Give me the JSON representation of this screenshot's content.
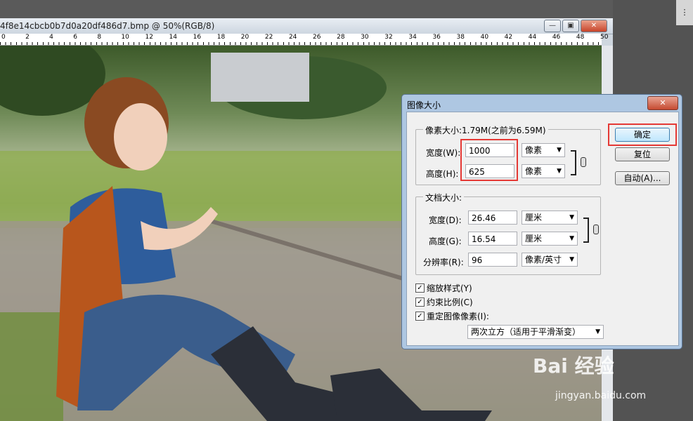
{
  "document": {
    "title": "4f8e14cbcb0b7d0a20df486d7.bmp @ 50%(RGB/8)",
    "window_buttons": [
      "—",
      "▣",
      "✕"
    ],
    "ruler_ticks": [
      "0",
      "2",
      "4",
      "6",
      "8",
      "10",
      "12",
      "14",
      "16",
      "18",
      "20",
      "22",
      "24",
      "26",
      "28",
      "30",
      "32",
      "34",
      "36",
      "38",
      "40",
      "42",
      "44",
      "46",
      "48",
      "50"
    ]
  },
  "dialog": {
    "title": "图像大小",
    "close_glyph": "✕",
    "pixel_group": {
      "legend": "像素大小:1.79M(之前为6.59M)",
      "width_label": "宽度(W):",
      "width_value": "1000",
      "width_unit": "像素",
      "height_label": "高度(H):",
      "height_value": "625",
      "height_unit": "像素"
    },
    "doc_group": {
      "legend": "文档大小:",
      "width_label": "宽度(D):",
      "width_value": "26.46",
      "width_unit": "厘米",
      "height_label": "高度(G):",
      "height_value": "16.54",
      "height_unit": "厘米",
      "res_label": "分辨率(R):",
      "res_value": "96",
      "res_unit": "像素/英寸"
    },
    "buttons": {
      "ok": "确定",
      "reset": "复位",
      "auto": "自动(A)..."
    },
    "checkboxes": [
      {
        "label": "缩放样式(Y)",
        "checked": true
      },
      {
        "label": "约束比例(C)",
        "checked": true
      },
      {
        "label": "重定图像像素(I):",
        "checked": true
      }
    ],
    "resample_method": "两次立方（适用于平滑渐变）"
  },
  "watermark": {
    "brand": "Bai 经验",
    "url": "jingyan.baidu.com"
  },
  "colors": {
    "dialog_frame": "#aec7e2",
    "highlight": "#e53935"
  }
}
